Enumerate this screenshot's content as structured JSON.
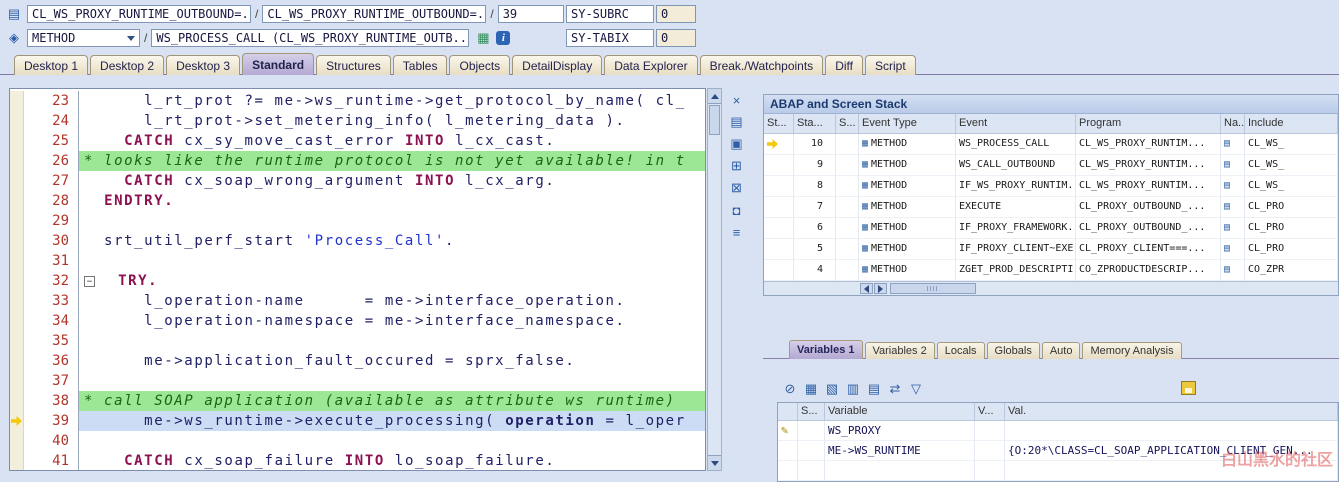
{
  "topbar": {
    "row1": {
      "doc_icon": "▤",
      "class_field": "CL_WS_PROXY_RUNTIME_OUTBOUND=...",
      "separator": "/",
      "class_field2": "CL_WS_PROXY_RUNTIME_OUTBOUND=...",
      "line_field": "39",
      "status_label": "SY-SUBRC",
      "status_value": "0"
    },
    "row2": {
      "mode_icon": "◈",
      "event_field": "METHOD",
      "separator": "/",
      "name_field": "WS_PROCESS_CALL (CL_WS_PROXY_RUNTIME_OUTB..",
      "table_icon": "▦",
      "info_icon": "i",
      "status_label": "SY-TABIX",
      "status_value": "0"
    }
  },
  "tabs": {
    "items": [
      "Desktop 1",
      "Desktop 2",
      "Desktop 3",
      "Standard",
      "Structures",
      "Tables",
      "Objects",
      "DetailDisplay",
      "Data Explorer",
      "Break./Watchpoints",
      "Diff",
      "Script"
    ],
    "active": "Standard"
  },
  "editor": {
    "lines": [
      {
        "no": "23",
        "segs": [
          [
            "c",
            "      l_rt_prot ?= me->ws_runtime->get_protocol_by_name( cl_"
          ]
        ]
      },
      {
        "no": "24",
        "segs": [
          [
            "c",
            "      l_rt_prot->set_metering_info( l_metering_data )."
          ]
        ]
      },
      {
        "no": "25",
        "segs": [
          [
            "c",
            "    "
          ],
          [
            "k",
            "CATCH"
          ],
          [
            "c",
            " cx_sy_move_cast_error "
          ],
          [
            "k",
            "INTO"
          ],
          [
            "c",
            " l_cx_cast."
          ]
        ]
      },
      {
        "no": "26",
        "hl": "comment",
        "segs": [
          [
            "cm",
            "* looks like the runtime protocol is not yet available! in t"
          ]
        ]
      },
      {
        "no": "27",
        "segs": [
          [
            "c",
            "    "
          ],
          [
            "k",
            "CATCH"
          ],
          [
            "c",
            " cx_soap_wrong_argument "
          ],
          [
            "k",
            "INTO"
          ],
          [
            "c",
            " l_cx_arg."
          ]
        ]
      },
      {
        "no": "28",
        "segs": [
          [
            "c",
            "  "
          ],
          [
            "k",
            "ENDTRY."
          ]
        ]
      },
      {
        "no": "29",
        "segs": []
      },
      {
        "no": "30",
        "segs": [
          [
            "c",
            "  srt_util_perf_start "
          ],
          [
            "s",
            "'Process_Call'"
          ],
          [
            "c",
            "."
          ]
        ]
      },
      {
        "no": "31",
        "segs": []
      },
      {
        "no": "32",
        "fold": true,
        "segs": [
          [
            "c",
            "  "
          ],
          [
            "k",
            "TRY."
          ]
        ]
      },
      {
        "no": "33",
        "segs": [
          [
            "c",
            "      l_operation-name      = me->interface_operation."
          ]
        ]
      },
      {
        "no": "34",
        "segs": [
          [
            "c",
            "      l_operation-namespace = me->interface_namespace."
          ]
        ]
      },
      {
        "no": "35",
        "segs": []
      },
      {
        "no": "36",
        "segs": [
          [
            "c",
            "      me->application_fault_occured = sprx_false."
          ]
        ]
      },
      {
        "no": "37",
        "segs": []
      },
      {
        "no": "38",
        "hl": "comment",
        "segs": [
          [
            "cm",
            "* call SOAP application (available as attribute ws runtime)"
          ]
        ]
      },
      {
        "no": "39",
        "hl": "current",
        "arrow": true,
        "segs": [
          [
            "c",
            "      me->ws_runtime->execute_processing( "
          ],
          [
            "b",
            "operation"
          ],
          [
            "c",
            " = l_oper"
          ]
        ]
      },
      {
        "no": "40",
        "segs": []
      },
      {
        "no": "41",
        "segs": [
          [
            "c",
            "    "
          ],
          [
            "k",
            "CATCH"
          ],
          [
            "c",
            " cx_soap_failure "
          ],
          [
            "k",
            "INTO"
          ],
          [
            "c",
            " lo_soap_failure."
          ]
        ]
      }
    ]
  },
  "service_icons": [
    {
      "name": "close-icon",
      "glyph": "×"
    },
    {
      "name": "new-window-icon",
      "glyph": "▤"
    },
    {
      "name": "copy-icon",
      "glyph": "▣"
    },
    {
      "name": "display-more-icon",
      "glyph": "⊞"
    },
    {
      "name": "delete-icon",
      "glyph": "⊠"
    },
    {
      "name": "lock-icon",
      "glyph": "◘"
    },
    {
      "name": "structure-icon",
      "glyph": "≡"
    }
  ],
  "stack": {
    "title": "ABAP and Screen Stack",
    "columns": [
      "St...",
      "Sta...",
      "S...",
      "Event Type",
      "Event",
      "Program",
      "Na...",
      "Include"
    ],
    "rows": [
      {
        "active": true,
        "level": "10",
        "event_type": "METHOD",
        "event": "WS_PROCESS_CALL",
        "program": "CL_WS_PROXY_RUNTIM...",
        "include": "CL_WS_"
      },
      {
        "active": false,
        "level": "9",
        "event_type": "METHOD",
        "event": "WS_CALL_OUTBOUND",
        "program": "CL_WS_PROXY_RUNTIM...",
        "include": "CL_WS_"
      },
      {
        "active": false,
        "level": "8",
        "event_type": "METHOD",
        "event": "IF_WS_PROXY_RUNTIM...",
        "program": "CL_WS_PROXY_RUNTIM...",
        "include": "CL_WS_"
      },
      {
        "active": false,
        "level": "7",
        "event_type": "METHOD",
        "event": "EXECUTE",
        "program": "CL_PROXY_OUTBOUND_...",
        "include": "CL_PRO"
      },
      {
        "active": false,
        "level": "6",
        "event_type": "METHOD",
        "event": "IF_PROXY_FRAMEWORK...",
        "program": "CL_PROXY_OUTBOUND_...",
        "include": "CL_PRO"
      },
      {
        "active": false,
        "level": "5",
        "event_type": "METHOD",
        "event": "IF_PROXY_CLIENT~EXE...",
        "program": "CL_PROXY_CLIENT===...",
        "include": "CL_PRO"
      },
      {
        "active": false,
        "level": "4",
        "event_type": "METHOD",
        "event": "ZGET_PROD_DESCRIPTI...",
        "program": "CO_ZPRODUCTDESCRIP...",
        "include": "CO_ZPR"
      }
    ]
  },
  "variables": {
    "tabs": [
      "Variables 1",
      "Variables 2",
      "Locals",
      "Globals",
      "Auto",
      "Memory Analysis"
    ],
    "active_tab": "Variables 1",
    "toolbar": [
      {
        "name": "delete-icon",
        "glyph": "⊘"
      },
      {
        "name": "table-view-icon",
        "glyph": "▦"
      },
      {
        "name": "table-edit-icon",
        "glyph": "▧"
      },
      {
        "name": "table-save-icon",
        "glyph": "▥"
      },
      {
        "name": "insert-columns-icon",
        "glyph": "▤"
      },
      {
        "name": "swap-icon",
        "glyph": "⇄"
      },
      {
        "name": "filter-icon",
        "glyph": "▽"
      }
    ],
    "columns": [
      "",
      "S...",
      "Variable",
      "V...",
      "Val."
    ],
    "rows": [
      {
        "icon_name": "edit-icon",
        "icon_glyph": "✎",
        "scope": "",
        "variable": "WS_PROXY",
        "vtype": "",
        "val": ""
      },
      {
        "icon_name": "",
        "icon_glyph": "",
        "scope": "",
        "variable": "ME->WS_RUNTIME",
        "vtype": "",
        "val": "{O:20*\\CLASS=CL_SOAP_APPLICATION_CLIENT_GEN..."
      },
      {
        "icon_name": "",
        "icon_glyph": "",
        "scope": "",
        "variable": "",
        "vtype": "",
        "val": ""
      }
    ]
  },
  "watermark": "白山黑水的社区"
}
